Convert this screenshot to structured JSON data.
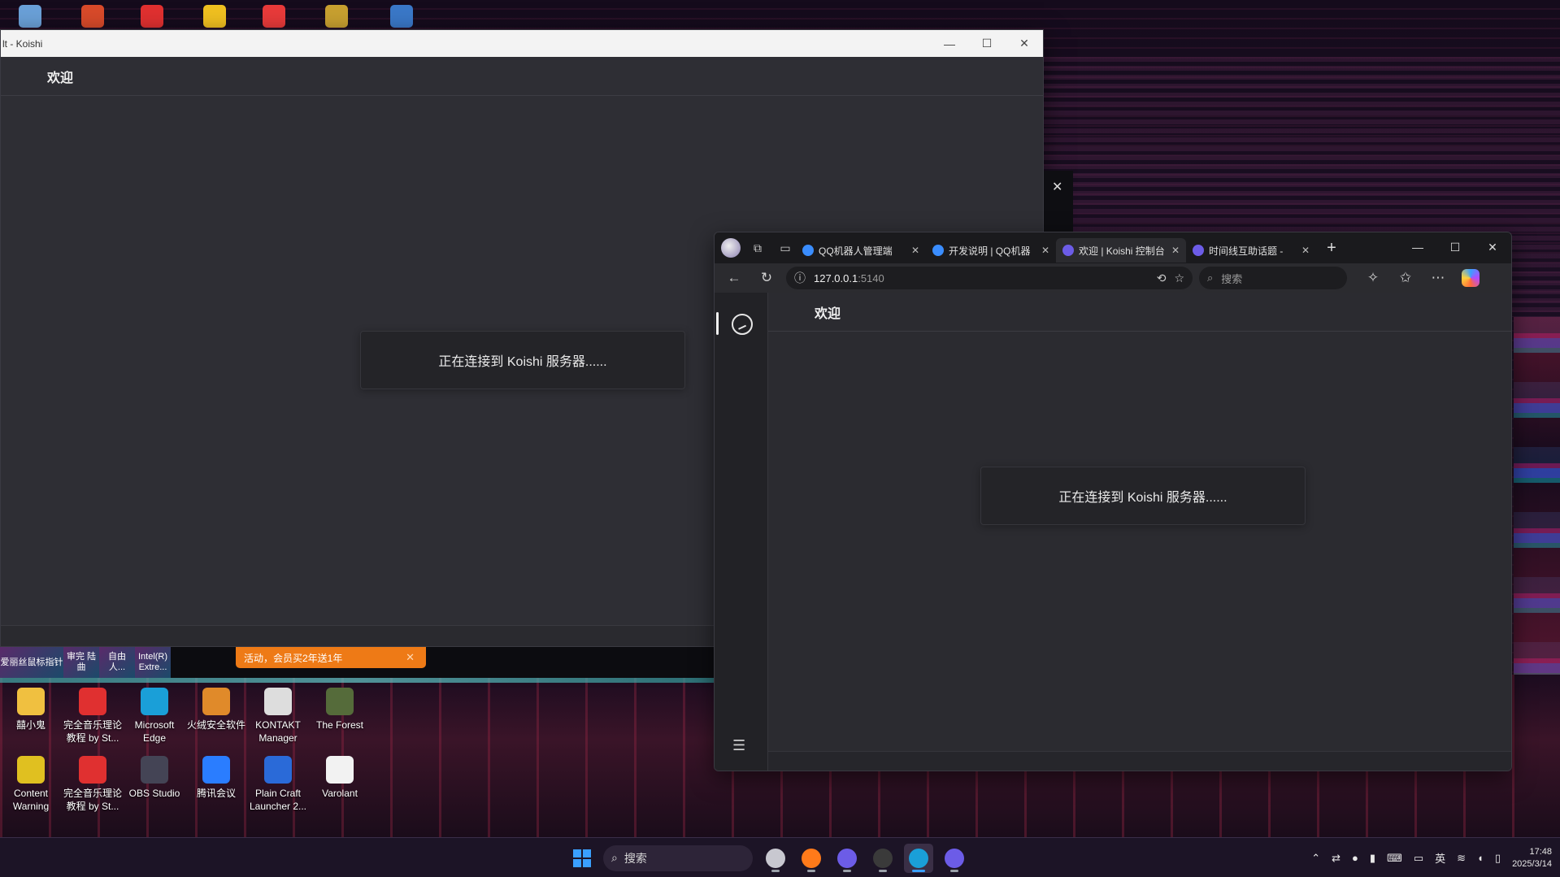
{
  "koishi_window": {
    "title": "lt - Koishi",
    "page_title": "欢迎",
    "connecting_message": "正在连接到 Koishi 服务器......",
    "caption": {
      "minimize": "—",
      "maximize": "☐",
      "close": "✕"
    }
  },
  "thumbnails": [
    {
      "label": "爱丽丝鼠标指针"
    },
    {
      "label": "审完 陆曲"
    },
    {
      "label": "自由 人..."
    },
    {
      "label": "Intel(R) Extre..."
    }
  ],
  "promo": {
    "text": "活动，会员买2年送1年",
    "close": "✕"
  },
  "popup": {
    "close": "✕"
  },
  "browser": {
    "tabs": [
      {
        "title": "QQ机器人管理端",
        "favicon_color": "#3a8dff",
        "active": false
      },
      {
        "title": "开发说明 | QQ机器",
        "favicon_color": "#3a8dff",
        "active": false
      },
      {
        "title": "欢迎 | Koishi 控制台",
        "favicon_color": "#6c5ce7",
        "active": true
      },
      {
        "title": "时间线互助话题 -",
        "favicon_color": "#6c5ce7",
        "active": false
      }
    ],
    "new_tab": "+",
    "caption": {
      "minimize": "—",
      "maximize": "☐",
      "close": "✕"
    },
    "url_host": "127.0.0.1",
    "url_port": ":5140",
    "search_placeholder": "搜索",
    "page_title": "欢迎",
    "connecting_message": "正在连接到 Koishi 服务器......"
  },
  "desktop_icons": [
    {
      "label": "囍小鬼",
      "color": "#f0c040"
    },
    {
      "label": "完全音乐理论教程 by St...",
      "color": "#e03030"
    },
    {
      "label": "Microsoft Edge",
      "color": "#1a9fd8"
    },
    {
      "label": "火绒安全软件",
      "color": "#e08a2a"
    },
    {
      "label": "KONTAKT Manager",
      "color": "#dddddd"
    },
    {
      "label": "The Forest",
      "color": "#556b3a"
    },
    {
      "label": "Content Warning",
      "color": "#e0c020"
    },
    {
      "label": "完全音乐理论教程 by St...",
      "color": "#e03030"
    },
    {
      "label": "OBS Studio",
      "color": "#444455"
    },
    {
      "label": "腾讯会议",
      "color": "#2a7dff"
    },
    {
      "label": "Plain Craft Launcher 2...",
      "color": "#2a6ad8"
    },
    {
      "label": "Varolant",
      "color": "#f2f2f2"
    }
  ],
  "top_icons": [
    {
      "name": "recycle-bin",
      "color": "#6aa0d8"
    },
    {
      "name": "app-4",
      "color": "#d84a2a"
    },
    {
      "name": "wps-pdf",
      "color": "#e03030"
    },
    {
      "name": "bypass",
      "color": "#f0c020"
    },
    {
      "name": "audio-app",
      "color": "#e83a3a"
    },
    {
      "name": "music-app",
      "color": "#c8a030"
    },
    {
      "name": "python",
      "color": "#3a78c8"
    }
  ],
  "taskbar": {
    "search_label": "搜索",
    "apps": [
      {
        "name": "task-view",
        "color": "#c8c8d0",
        "active": false
      },
      {
        "name": "firefox",
        "color": "#ff7a1a",
        "active": false
      },
      {
        "name": "koishi",
        "color": "#6c5ce7",
        "active": false
      },
      {
        "name": "terminal",
        "color": "#3a3a3a",
        "active": false
      },
      {
        "name": "edge",
        "color": "#1a9fd8",
        "active": true
      },
      {
        "name": "koishi-2",
        "color": "#6c5ce7",
        "active": false
      }
    ],
    "ime": "英",
    "time": "17:48",
    "date": "2025/3/14"
  }
}
